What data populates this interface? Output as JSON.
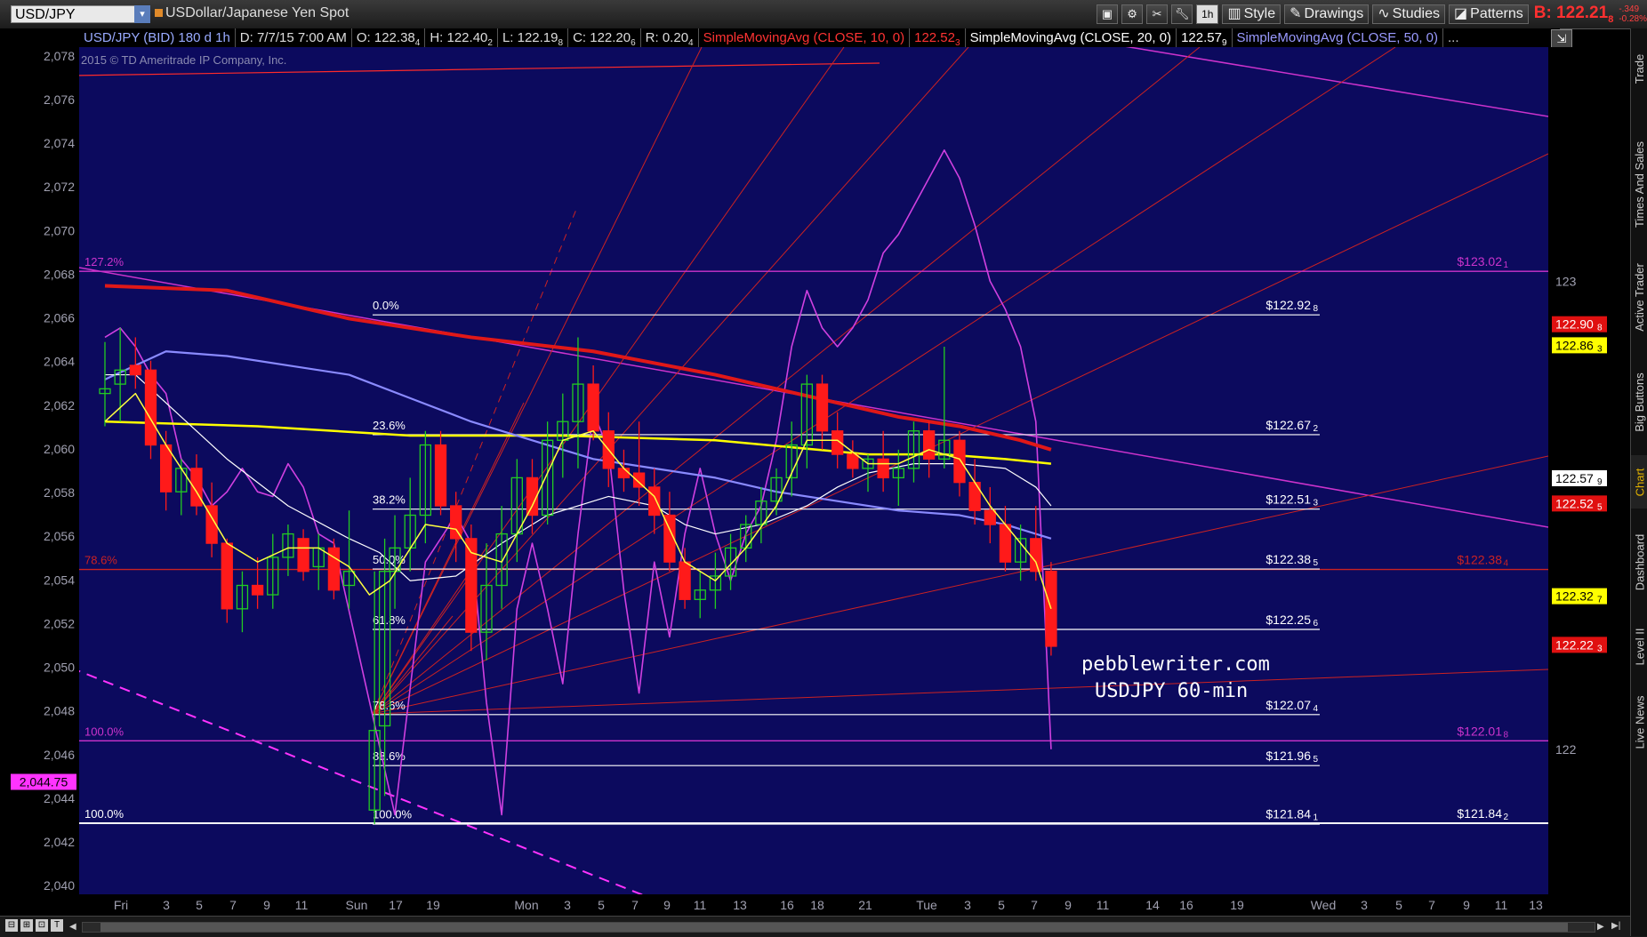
{
  "header": {
    "symbol": "USD/JPY",
    "description": "USDollar/Japanese Yen Spot",
    "timeframe_button": "1h",
    "style_label": "Style",
    "drawings_label": "Drawings",
    "studies_label": "Studies",
    "patterns_label": "Patterns",
    "bid_label": "B: 122.21",
    "bid_sub": "8",
    "change_top": "-.349",
    "change_bottom": "-0.28%"
  },
  "study_bar": {
    "instrument": "USD/JPY (BID) 180 d 1h",
    "date": "D: 7/7/15 7:00 AM",
    "open": "O: 122.38",
    "open_sub": "4",
    "high": "H: 122.40",
    "high_sub": "2",
    "low": "L: 122.19",
    "low_sub": "8",
    "close": "C: 122.20",
    "close_sub": "6",
    "range": "R: 0.20",
    "range_sub": "4",
    "sma10": "SimpleMovingAvg (CLOSE, 10, 0)",
    "sma10_val": "122.52",
    "sma10_sub": "3",
    "sma20": "SimpleMovingAvg (CLOSE, 20, 0)",
    "sma20_val": "122.57",
    "sma20_sub": "9",
    "sma50": "SimpleMovingAvg (CLOSE, 50, 0)",
    "sma50_val": "...",
    "colors": {
      "sma10": "#ff3333",
      "sma20": "#ffffff",
      "sma50": "#8a8aff"
    }
  },
  "sidebar": {
    "tabs": [
      "Trade",
      "Times And Sales",
      "Active Trader",
      "Big Buttons",
      "Chart",
      "Dashboard",
      "Level II",
      "Live News"
    ]
  },
  "chart_data": {
    "type": "candlestick",
    "title": "USDJPY 60-min",
    "watermark": "pebblewriter.com",
    "copyright": "2015 © TD Ameritrade IP Company, Inc.",
    "left_axis": {
      "label": "",
      "ticks": [
        "2,078",
        "2,076",
        "2,074",
        "2,072",
        "2,070",
        "2,068",
        "2,066",
        "2,064",
        "2,062",
        "2,060",
        "2,058",
        "2,056",
        "2,054",
        "2,052",
        "2,050",
        "2,048",
        "2,046",
        "2,044",
        "2,042",
        "2,040"
      ],
      "range": [
        2039.6,
        2078.4
      ],
      "current_marker": "2,044.75",
      "current_value": 2044.75
    },
    "right_axis": {
      "ticks": [
        {
          "label": "123",
          "value": 123.0
        },
        {
          "label": "122",
          "value": 122.0
        }
      ],
      "range": [
        121.69,
        123.5
      ]
    },
    "x_axis": {
      "ticks": [
        "Fri",
        "3",
        "5",
        "7",
        "9",
        "11",
        "Sun",
        "17",
        "19",
        "Mon",
        "3",
        "5",
        "7",
        "9",
        "11",
        "13",
        "16",
        "18",
        "21",
        "Tue",
        "3",
        "5",
        "7",
        "9",
        "11",
        "14",
        "16",
        "19",
        "Wed",
        "3",
        "5",
        "7",
        "9",
        "11",
        "13"
      ]
    },
    "fib_levels": [
      {
        "label": "0.0%",
        "price": "$122.92",
        "price_sub": "8",
        "value": 122.928
      },
      {
        "label": "23.6%",
        "price": "$122.67",
        "price_sub": "2",
        "value": 122.672
      },
      {
        "label": "38.2%",
        "price": "$122.51",
        "price_sub": "3",
        "value": 122.513
      },
      {
        "label": "50.0%",
        "price": "$122.38",
        "price_sub": "5",
        "value": 122.385
      },
      {
        "label": "61.8%",
        "price": "$122.25",
        "price_sub": "6",
        "value": 122.256
      },
      {
        "label": "78.6%",
        "price": "$122.07",
        "price_sub": "4",
        "value": 122.074
      },
      {
        "label": "88.6%",
        "price": "$121.96",
        "price_sub": "5",
        "value": 121.965
      },
      {
        "label": "100.0%",
        "price": "$121.84",
        "price_sub": "1",
        "value": 121.841
      }
    ],
    "other_levels": [
      {
        "label": "127.2%",
        "price": "$123.02",
        "price_sub": "1",
        "value": 123.021,
        "color": "#cc33cc"
      },
      {
        "label": "78.6%",
        "price": "$122.38",
        "price_sub": "4",
        "value": 122.384,
        "color": "#cc2222"
      },
      {
        "label": "100.0%",
        "price": "$122.01",
        "price_sub": "8",
        "value": 122.018,
        "color": "#cc33cc"
      },
      {
        "label": "100.0%",
        "price": "$121.84",
        "price_sub": "2",
        "value": 121.842,
        "color": "#ffffff"
      }
    ],
    "right_price_boxes": [
      {
        "label": "122.90",
        "sub": "8",
        "value": 122.908,
        "bg": "#e01010",
        "fg": "#ffffff"
      },
      {
        "label": "122.86",
        "sub": "3",
        "value": 122.863,
        "bg": "#ffff00",
        "fg": "#000000"
      },
      {
        "label": "122.57",
        "sub": "9",
        "value": 122.579,
        "bg": "#ffffff",
        "fg": "#000000"
      },
      {
        "label": "122.52",
        "sub": "5",
        "value": 122.525,
        "bg": "#e01010",
        "fg": "#ffffff"
      },
      {
        "label": "122.32",
        "sub": "7",
        "value": 122.327,
        "bg": "#ffff00",
        "fg": "#000000"
      },
      {
        "label": "122.22",
        "sub": "3",
        "value": 122.223,
        "bg": "#e01010",
        "fg": "#ffffff"
      }
    ],
    "candles": [
      [
        0.0,
        122.76,
        122.87,
        122.69,
        122.77
      ],
      [
        0.6,
        122.78,
        122.9,
        122.7,
        122.81
      ],
      [
        1.2,
        122.82,
        122.88,
        122.77,
        122.8
      ],
      [
        1.8,
        122.81,
        122.83,
        122.62,
        122.65
      ],
      [
        2.4,
        122.65,
        122.68,
        122.51,
        122.55
      ],
      [
        3.0,
        122.55,
        122.62,
        122.5,
        122.6
      ],
      [
        3.6,
        122.6,
        122.63,
        122.5,
        122.52
      ],
      [
        4.2,
        122.52,
        122.57,
        122.41,
        122.44
      ],
      [
        4.8,
        122.44,
        122.45,
        122.27,
        122.3
      ],
      [
        5.4,
        122.3,
        122.38,
        122.25,
        122.35
      ],
      [
        6.0,
        122.35,
        122.41,
        122.3,
        122.33
      ],
      [
        6.6,
        122.33,
        122.46,
        122.3,
        122.41
      ],
      [
        7.2,
        122.41,
        122.48,
        122.37,
        122.46
      ],
      [
        7.8,
        122.45,
        122.47,
        122.36,
        122.38
      ],
      [
        8.4,
        122.39,
        122.46,
        122.34,
        122.43
      ],
      [
        9.0,
        122.43,
        122.45,
        122.32,
        122.34
      ],
      [
        9.6,
        122.35,
        122.51,
        122.3,
        122.38
      ],
      [
        10.6,
        121.87,
        122.38,
        121.84,
        122.04
      ],
      [
        11.0,
        122.05,
        122.45,
        121.9,
        122.38
      ],
      [
        11.4,
        122.38,
        122.5,
        122.3,
        122.43
      ],
      [
        12.0,
        122.43,
        122.58,
        122.38,
        122.5
      ],
      [
        12.6,
        122.5,
        122.68,
        122.44,
        122.65
      ],
      [
        13.2,
        122.65,
        122.68,
        122.5,
        122.52
      ],
      [
        13.8,
        122.52,
        122.55,
        122.4,
        122.45
      ],
      [
        14.4,
        122.45,
        122.48,
        122.21,
        122.25
      ],
      [
        15.0,
        122.25,
        122.44,
        122.19,
        122.35
      ],
      [
        15.6,
        122.35,
        122.52,
        122.3,
        122.46
      ],
      [
        16.2,
        122.46,
        122.62,
        122.4,
        122.58
      ],
      [
        16.8,
        122.58,
        122.62,
        122.46,
        122.5
      ],
      [
        17.4,
        122.5,
        122.7,
        122.48,
        122.66
      ],
      [
        18.0,
        122.66,
        122.76,
        122.58,
        122.7
      ],
      [
        18.6,
        122.7,
        122.88,
        122.6,
        122.78
      ],
      [
        19.2,
        122.78,
        122.82,
        122.66,
        122.68
      ],
      [
        19.8,
        122.68,
        122.72,
        122.56,
        122.6
      ],
      [
        20.4,
        122.6,
        122.64,
        122.55,
        122.58
      ],
      [
        21.0,
        122.59,
        122.7,
        122.52,
        122.56
      ],
      [
        21.6,
        122.56,
        122.6,
        122.46,
        122.5
      ],
      [
        22.2,
        122.5,
        122.55,
        122.38,
        122.4
      ],
      [
        22.8,
        122.4,
        122.43,
        122.3,
        122.32
      ],
      [
        23.4,
        122.32,
        122.38,
        122.28,
        122.34
      ],
      [
        24.0,
        122.34,
        122.42,
        122.3,
        122.37
      ],
      [
        24.6,
        122.37,
        122.46,
        122.34,
        122.43
      ],
      [
        25.2,
        122.43,
        122.5,
        122.4,
        122.48
      ],
      [
        25.8,
        122.48,
        122.56,
        122.44,
        122.53
      ],
      [
        26.4,
        122.53,
        122.6,
        122.5,
        122.58
      ],
      [
        27.0,
        122.58,
        122.7,
        122.54,
        122.65
      ],
      [
        27.6,
        122.65,
        122.8,
        122.6,
        122.78
      ],
      [
        28.2,
        122.78,
        122.8,
        122.64,
        122.68
      ],
      [
        28.8,
        122.68,
        122.72,
        122.6,
        122.63
      ],
      [
        29.4,
        122.63,
        122.66,
        122.58,
        122.6
      ],
      [
        30.0,
        122.6,
        122.63,
        122.55,
        122.62
      ],
      [
        30.6,
        122.62,
        122.68,
        122.55,
        122.58
      ],
      [
        31.2,
        122.58,
        122.64,
        122.52,
        122.6
      ],
      [
        31.8,
        122.6,
        122.7,
        122.57,
        122.68
      ],
      [
        32.4,
        122.68,
        122.7,
        122.58,
        122.62
      ],
      [
        33.0,
        122.62,
        122.86,
        122.6,
        122.66
      ],
      [
        33.6,
        122.66,
        122.68,
        122.54,
        122.57
      ],
      [
        34.2,
        122.57,
        122.62,
        122.48,
        122.51
      ],
      [
        34.8,
        122.51,
        122.56,
        122.44,
        122.48
      ],
      [
        35.4,
        122.48,
        122.52,
        122.38,
        122.4
      ],
      [
        36.0,
        122.4,
        122.48,
        122.36,
        122.45
      ],
      [
        36.6,
        122.45,
        122.52,
        122.36,
        122.38
      ],
      [
        37.2,
        122.38,
        122.4,
        122.2,
        122.22
      ]
    ],
    "bar_count": 37.8,
    "sma10_points": [
      [
        0,
        122.7
      ],
      [
        1.2,
        122.76
      ],
      [
        2.4,
        122.65
      ],
      [
        3.6,
        122.55
      ],
      [
        4.8,
        122.44
      ],
      [
        6,
        122.4
      ],
      [
        7.2,
        122.43
      ],
      [
        8.4,
        122.43
      ],
      [
        9.6,
        122.39
      ],
      [
        10.4,
        122.33
      ],
      [
        11.2,
        122.36
      ],
      [
        12.6,
        122.48
      ],
      [
        13.8,
        122.47
      ],
      [
        14.4,
        122.42
      ],
      [
        15.6,
        122.4
      ],
      [
        16.8,
        122.52
      ],
      [
        18,
        122.66
      ],
      [
        19.2,
        122.68
      ],
      [
        20.4,
        122.6
      ],
      [
        21.6,
        122.54
      ],
      [
        22.8,
        122.4
      ],
      [
        24,
        122.36
      ],
      [
        25.2,
        122.43
      ],
      [
        26.4,
        122.52
      ],
      [
        27.6,
        122.66
      ],
      [
        28.8,
        122.66
      ],
      [
        30,
        122.61
      ],
      [
        31.2,
        122.61
      ],
      [
        32.4,
        122.64
      ],
      [
        33.6,
        122.62
      ],
      [
        34.8,
        122.52
      ],
      [
        36,
        122.44
      ],
      [
        36.6,
        122.4
      ],
      [
        37.2,
        122.3
      ]
    ],
    "sma20_points": [
      [
        0,
        122.8
      ],
      [
        1.2,
        122.8
      ],
      [
        2.4,
        122.74
      ],
      [
        4.8,
        122.62
      ],
      [
        7.2,
        122.52
      ],
      [
        9.6,
        122.45
      ],
      [
        10.8,
        122.42
      ],
      [
        12,
        122.36
      ],
      [
        13.8,
        122.37
      ],
      [
        15.6,
        122.44
      ],
      [
        17.4,
        122.5
      ],
      [
        19.8,
        122.54
      ],
      [
        21.6,
        122.52
      ],
      [
        22.8,
        122.48
      ],
      [
        24,
        122.46
      ],
      [
        25.8,
        122.48
      ],
      [
        27.6,
        122.52
      ],
      [
        28.8,
        122.56
      ],
      [
        30,
        122.59
      ],
      [
        31.8,
        122.61
      ],
      [
        33.6,
        122.61
      ],
      [
        35.4,
        122.6
      ],
      [
        36.6,
        122.56
      ],
      [
        37.2,
        122.52
      ]
    ],
    "sma50_points": [
      [
        0,
        122.79
      ],
      [
        2.4,
        122.85
      ],
      [
        4.8,
        122.84
      ],
      [
        7.2,
        122.82
      ],
      [
        9.6,
        122.8
      ],
      [
        12,
        122.75
      ],
      [
        14.4,
        122.7
      ],
      [
        16.8,
        122.66
      ],
      [
        19.2,
        122.62
      ],
      [
        21.6,
        122.6
      ],
      [
        24,
        122.58
      ],
      [
        26.4,
        122.55
      ],
      [
        28.8,
        122.53
      ],
      [
        31.2,
        122.51
      ],
      [
        33.6,
        122.5
      ],
      [
        35.4,
        122.48
      ],
      [
        37.2,
        122.45
      ]
    ],
    "sma200_points": [
      [
        0,
        122.7
      ],
      [
        6,
        122.69
      ],
      [
        12,
        122.67
      ],
      [
        18,
        122.67
      ],
      [
        24,
        122.66
      ],
      [
        30,
        122.63
      ],
      [
        33,
        122.63
      ],
      [
        35.4,
        122.62
      ],
      [
        37.2,
        122.61
      ]
    ],
    "sma100_points": [
      [
        0,
        122.99
      ],
      [
        4.8,
        122.98
      ],
      [
        9.6,
        122.92
      ],
      [
        14.4,
        122.88
      ],
      [
        19.2,
        122.85
      ],
      [
        24,
        122.8
      ],
      [
        28.8,
        122.74
      ],
      [
        31.2,
        122.71
      ],
      [
        33.6,
        122.69
      ],
      [
        36,
        122.66
      ],
      [
        37.2,
        122.64
      ]
    ],
    "magenta_osc_points": [
      [
        0,
        122.88
      ],
      [
        0.6,
        122.9
      ],
      [
        1.2,
        122.86
      ],
      [
        1.8,
        122.8
      ],
      [
        2.4,
        122.76
      ],
      [
        3.0,
        122.62
      ],
      [
        3.6,
        122.58
      ],
      [
        4.2,
        122.52
      ],
      [
        4.8,
        122.55
      ],
      [
        5.4,
        122.6
      ],
      [
        6.0,
        122.55
      ],
      [
        6.6,
        122.54
      ],
      [
        7.2,
        122.61
      ],
      [
        7.8,
        122.56
      ],
      [
        8.4,
        122.46
      ],
      [
        9.0,
        122.44
      ],
      [
        11.4,
        121.86
      ],
      [
        12.6,
        122.4
      ],
      [
        13.8,
        122.5
      ],
      [
        14.4,
        122.44
      ],
      [
        15.0,
        122.1
      ],
      [
        15.6,
        121.86
      ],
      [
        16.2,
        122.3
      ],
      [
        16.8,
        122.44
      ],
      [
        17.4,
        122.3
      ],
      [
        18.0,
        122.14
      ],
      [
        18.6,
        122.46
      ],
      [
        19.2,
        122.72
      ],
      [
        19.8,
        122.64
      ],
      [
        20.4,
        122.34
      ],
      [
        21.0,
        122.12
      ],
      [
        21.6,
        122.4
      ],
      [
        22.2,
        122.24
      ],
      [
        22.8,
        122.46
      ],
      [
        23.4,
        122.6
      ],
      [
        24.0,
        122.46
      ],
      [
        24.6,
        122.36
      ],
      [
        25.2,
        122.46
      ],
      [
        25.8,
        122.52
      ],
      [
        26.4,
        122.66
      ],
      [
        27.0,
        122.86
      ],
      [
        27.6,
        122.98
      ],
      [
        28.2,
        122.9
      ],
      [
        28.8,
        122.86
      ],
      [
        29.4,
        122.9
      ],
      [
        30.0,
        122.96
      ],
      [
        30.6,
        123.06
      ],
      [
        31.2,
        123.1
      ],
      [
        31.8,
        123.16
      ],
      [
        32.4,
        123.22
      ],
      [
        33.0,
        123.28
      ],
      [
        33.6,
        123.22
      ],
      [
        34.2,
        123.12
      ],
      [
        34.8,
        123.0
      ],
      [
        35.4,
        122.94
      ],
      [
        36.0,
        122.86
      ],
      [
        36.6,
        122.7
      ],
      [
        37.2,
        122.0
      ]
    ]
  }
}
